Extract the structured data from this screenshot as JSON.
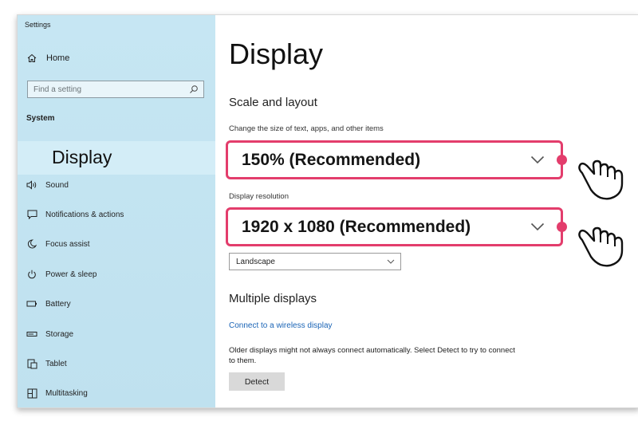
{
  "window": {
    "title": "Settings"
  },
  "sidebar": {
    "home_label": "Home",
    "search_placeholder": "Find a setting",
    "section_label": "System",
    "selected_label": "Display",
    "items": [
      {
        "label": "Sound",
        "icon": "speaker-icon"
      },
      {
        "label": "Notifications & actions",
        "icon": "notification-icon"
      },
      {
        "label": "Focus assist",
        "icon": "moon-icon"
      },
      {
        "label": "Power & sleep",
        "icon": "power-icon"
      },
      {
        "label": "Battery",
        "icon": "battery-icon"
      },
      {
        "label": "Storage",
        "icon": "storage-icon"
      },
      {
        "label": "Tablet",
        "icon": "tablet-icon"
      },
      {
        "label": "Multitasking",
        "icon": "multitasking-icon"
      }
    ]
  },
  "main": {
    "title": "Display",
    "scale_heading": "Scale and layout",
    "scale_label": "Change the size of text, apps, and other items",
    "scale_value": "150% (Recommended)",
    "resolution_label": "Display resolution",
    "resolution_value": "1920 x 1080 (Recommended)",
    "orientation_value": "Landscape",
    "multiple_heading": "Multiple displays",
    "wireless_link": "Connect to a wireless display",
    "detect_description": "Older displays might not always connect automatically. Select Detect to try to connect to them.",
    "detect_button": "Detect"
  },
  "colors": {
    "sidebar_bg": "#c6e6f3",
    "highlight": "#e33d6c",
    "link": "#1a64b6",
    "button_bg": "#d9d9d9"
  }
}
